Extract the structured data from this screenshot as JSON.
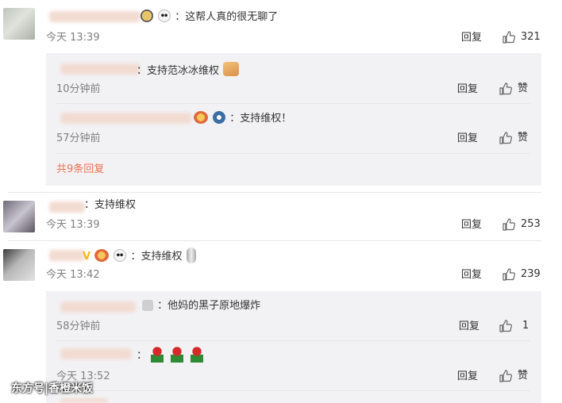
{
  "common": {
    "reply_label": "回复",
    "like_label": "赞"
  },
  "comments": [
    {
      "text": "：这帮人真的很无聊了",
      "time": "今天 13:39",
      "likes": "321",
      "replies": [
        {
          "text": "：支持范冰冰维权",
          "time": "10分钟前"
        },
        {
          "text": "：支持维权！",
          "time": "57分钟前"
        }
      ],
      "more_label": "共9条回复"
    },
    {
      "text": "：支持维权",
      "time": "今天 13:39",
      "likes": "253"
    },
    {
      "text": "：支持维权",
      "time": "今天 13:42",
      "likes": "239",
      "replies": [
        {
          "text": "：他妈的黑子原地爆炸",
          "time": "58分钟前",
          "likes": "1"
        },
        {
          "text": "：",
          "time": "今天 13:52"
        }
      ]
    }
  ],
  "watermark": "东方号|香橙米饭"
}
